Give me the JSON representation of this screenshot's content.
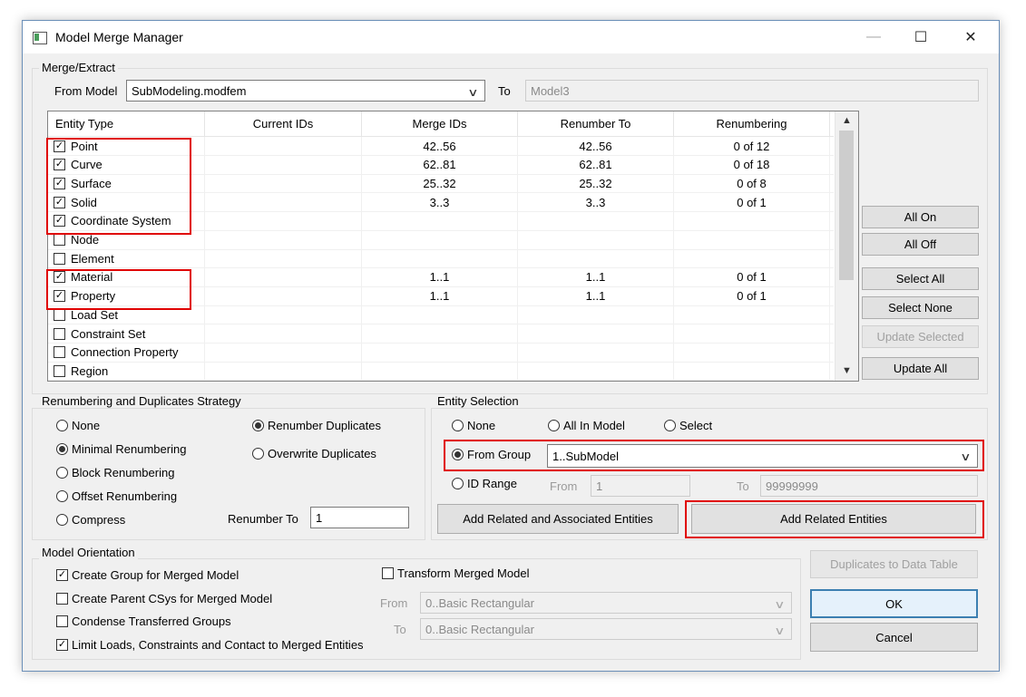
{
  "window": {
    "title": "Model Merge Manager",
    "minimize_glyph": "—",
    "maximize_glyph": "☐",
    "close_glyph": "✕"
  },
  "merge_extract": {
    "legend": "Merge/Extract",
    "from_model_label": "From Model",
    "from_model_value": "SubModeling.modfem",
    "to_label": "To",
    "to_value": "Model3"
  },
  "table": {
    "columns": [
      "Entity Type",
      "Current IDs",
      "Merge IDs",
      "Renumber To",
      "Renumbering"
    ],
    "rows": [
      {
        "checked": true,
        "check_glyph": "✓",
        "entity": "Point",
        "current": "",
        "merge": "42..56",
        "renumber_to": "42..56",
        "renumbering": "0 of 12"
      },
      {
        "checked": true,
        "check_glyph": "✓",
        "entity": "Curve",
        "current": "",
        "merge": "62..81",
        "renumber_to": "62..81",
        "renumbering": "0 of 18"
      },
      {
        "checked": true,
        "check_glyph": "✓",
        "entity": "Surface",
        "current": "",
        "merge": "25..32",
        "renumber_to": "25..32",
        "renumbering": "0 of 8"
      },
      {
        "checked": true,
        "check_glyph": "✓",
        "entity": "Solid",
        "current": "",
        "merge": "3..3",
        "renumber_to": "3..3",
        "renumbering": "0 of 1"
      },
      {
        "checked": true,
        "check_glyph": "✓",
        "entity": "Coordinate System",
        "current": "",
        "merge": "",
        "renumber_to": "",
        "renumbering": ""
      },
      {
        "checked": false,
        "check_glyph": "",
        "entity": "Node",
        "current": "",
        "merge": "",
        "renumber_to": "",
        "renumbering": ""
      },
      {
        "checked": false,
        "check_glyph": "",
        "entity": "Element",
        "current": "",
        "merge": "",
        "renumber_to": "",
        "renumbering": ""
      },
      {
        "checked": true,
        "check_glyph": "✓",
        "entity": "Material",
        "current": "",
        "merge": "1..1",
        "renumber_to": "1..1",
        "renumbering": "0 of 1"
      },
      {
        "checked": true,
        "check_glyph": "✓",
        "entity": "Property",
        "current": "",
        "merge": "1..1",
        "renumber_to": "1..1",
        "renumbering": "0 of 1"
      },
      {
        "checked": false,
        "check_glyph": "",
        "entity": "Load Set",
        "current": "",
        "merge": "",
        "renumber_to": "",
        "renumbering": ""
      },
      {
        "checked": false,
        "check_glyph": "",
        "entity": "Constraint Set",
        "current": "",
        "merge": "",
        "renumber_to": "",
        "renumbering": ""
      },
      {
        "checked": false,
        "check_glyph": "",
        "entity": "Connection Property",
        "current": "",
        "merge": "",
        "renumber_to": "",
        "renumbering": ""
      },
      {
        "checked": false,
        "check_glyph": "",
        "entity": "Region",
        "current": "",
        "merge": "",
        "renumber_to": "",
        "renumbering": ""
      }
    ],
    "scroll_up_glyph": "▲",
    "scroll_down_glyph": "▼"
  },
  "side_buttons": {
    "all_on": "All On",
    "all_off": "All Off",
    "select_all": "Select All",
    "select_none": "Select None",
    "update_selected": "Update Selected",
    "update_all": "Update All"
  },
  "renumbering": {
    "legend": "Renumbering and Duplicates Strategy",
    "options": [
      {
        "label": "None",
        "selected": false
      },
      {
        "label": "Minimal Renumbering",
        "selected": true
      },
      {
        "label": "Block Renumbering",
        "selected": false
      },
      {
        "label": "Offset Renumbering",
        "selected": false
      },
      {
        "label": "Compress",
        "selected": false
      }
    ],
    "duplicates": [
      {
        "label": "Renumber Duplicates",
        "selected": true
      },
      {
        "label": "Overwrite Duplicates",
        "selected": false
      }
    ],
    "renumber_to_label": "Renumber To",
    "renumber_to_value": "1"
  },
  "entity_selection": {
    "legend": "Entity Selection",
    "none": "None",
    "all_in_model": "All In Model",
    "select": "Select",
    "from_group": "From Group",
    "from_group_value": "1..SubModel",
    "id_range": "ID Range",
    "from_label": "From",
    "from_value": "1",
    "to_label": "To",
    "to_value": "99999999",
    "add_related_associated": "Add Related and Associated Entities",
    "add_related": "Add Related Entities"
  },
  "orientation": {
    "legend": "Model Orientation",
    "create_group": "Create Group for Merged Model",
    "create_parent_csys": "Create Parent CSys for Merged Model",
    "condense_groups": "Condense Transferred Groups",
    "limit_loads": "Limit Loads, Constraints and Contact to Merged Entities",
    "transform": "Transform Merged Model",
    "from_label": "From",
    "from_value": "0..Basic Rectangular",
    "to_label": "To",
    "to_value": "0..Basic Rectangular",
    "check_glyph": "✓"
  },
  "bottom_buttons": {
    "duplicates_to_table": "Duplicates to Data Table",
    "ok": "OK",
    "cancel": "Cancel"
  },
  "colors": {
    "highlight": "#e00000",
    "default_button": "#3c7fb1"
  },
  "dropdown_glyph": "∨"
}
